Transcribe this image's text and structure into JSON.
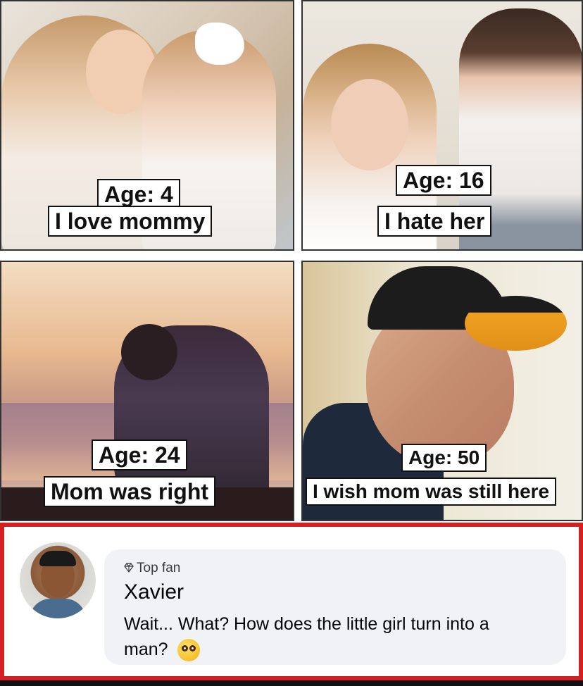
{
  "panels": [
    {
      "age": "Age: 4",
      "caption": "I love mommy"
    },
    {
      "age": "Age: 16",
      "caption": "I hate her"
    },
    {
      "age": "Age: 24",
      "caption": "Mom was right"
    },
    {
      "age": "Age: 50",
      "caption": "I wish mom was still here"
    }
  ],
  "comment": {
    "badge": "Top fan",
    "badge_icon": "diamond-icon",
    "author": "Xavier",
    "text": "Wait... What? How does the little girl turn into a man?",
    "emoji": "flushed-face-emoji"
  },
  "colors": {
    "frame": "#d42020",
    "bubble": "#f0f2f5"
  }
}
